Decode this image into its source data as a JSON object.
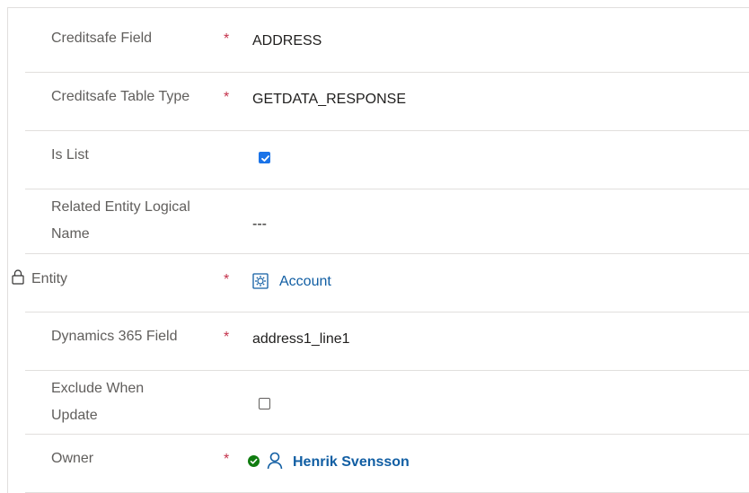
{
  "fields": [
    {
      "label": "Creditsafe Field",
      "required": "*",
      "value": "ADDRESS"
    },
    {
      "label": "Creditsafe Table Type",
      "required": "*",
      "value": "GETDATA_RESPONSE"
    },
    {
      "label": "Is List",
      "checked": true
    },
    {
      "label_line1": "Related Entity Logical",
      "label_line2": "Name",
      "value": "---"
    },
    {
      "label": "Entity",
      "required": "*",
      "value": "Account",
      "icon": "entity-icon",
      "lock_icon": "lock-icon"
    },
    {
      "label": "Dynamics 365 Field",
      "required": "*",
      "value": "address1_line1"
    },
    {
      "label_line1": "Exclude When",
      "label_line2": "Update",
      "checked": false
    },
    {
      "label": "Owner",
      "required": "*",
      "value": "Henrik Svensson",
      "status_icon": "check-circle-icon",
      "icon": "person-icon"
    }
  ],
  "colors": {
    "link": "#115ea3",
    "required": "#c4314b",
    "check": "#1a73e8",
    "success": "#107c10"
  }
}
